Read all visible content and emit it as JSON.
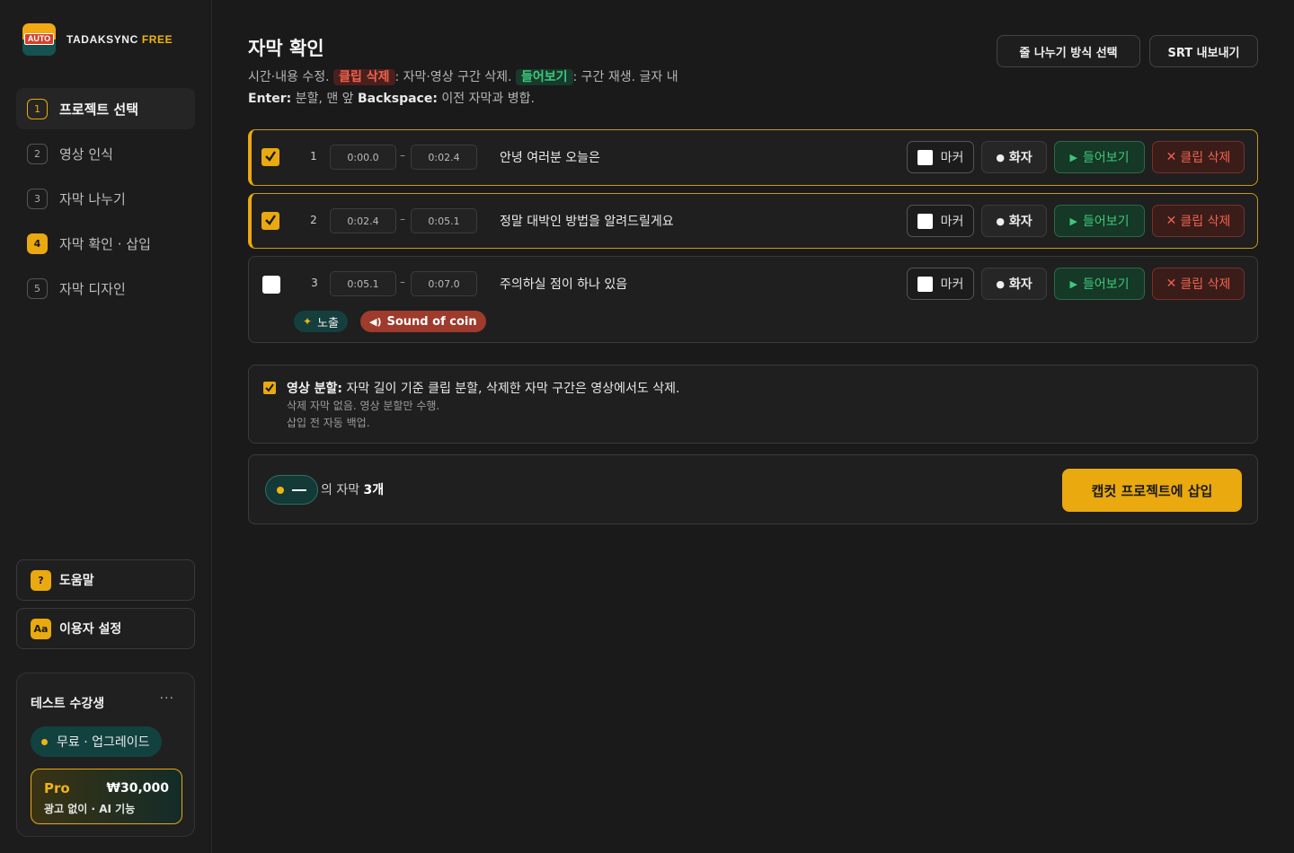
{
  "brand": {
    "logo_text": "AUTO",
    "name": "TADAKSYNC",
    "tier": "FREE"
  },
  "steps": [
    {
      "num": "1",
      "label": "프로젝트 선택"
    },
    {
      "num": "2",
      "label": "영상 인식"
    },
    {
      "num": "3",
      "label": "자막 나누기"
    },
    {
      "num": "4",
      "label": "자막 확인 · 삽입"
    },
    {
      "num": "5",
      "label": "자막 디자인"
    }
  ],
  "help": {
    "icon": "?",
    "label": "도움말"
  },
  "settings": {
    "icon": "Aa",
    "label": "이용자 설정"
  },
  "user": {
    "name": "테스트 수강생",
    "more": "···",
    "plan": "무료 · 업그레이드",
    "pro": {
      "name": "Pro",
      "price": "₩30,000",
      "desc": "광고 없이 · AI 기능"
    }
  },
  "header": {
    "title": "자막 확인",
    "desc_1": "시간·내용 수정. ",
    "tag_delete": "클립 삭제",
    "desc_2": ": 자막·영상 구간 삭제. ",
    "tag_listen": "들어보기",
    "desc_3": ": 구간 재생. 글자 내 ",
    "key_enter": "Enter:",
    "desc_4": " 분할, 맨 앞 ",
    "key_backspace": "Backspace:",
    "desc_5": " 이전 자막과 병합.",
    "btn_line_break": "줄 나누기 방식 선택",
    "btn_srt": "SRT 내보내기"
  },
  "row_labels": {
    "marker": "마커",
    "speaker": "화자",
    "play": "들어보기",
    "delete": "클립 삭제",
    "dash": "–"
  },
  "subtitles": [
    {
      "num": "1",
      "start": "0:00.0",
      "end": "0:02.4",
      "text": "안녕 여러분 오늘은",
      "checked": true
    },
    {
      "num": "2",
      "start": "0:02.4",
      "end": "0:05.1",
      "text": "정말 대박인 방법을 알려드릴게요",
      "checked": true
    },
    {
      "num": "3",
      "start": "0:05.1",
      "end": "0:07.0",
      "text": "주의하실 점이 하나 있음",
      "checked": false,
      "chips": [
        {
          "label": "노출",
          "color": "#153f3c"
        },
        {
          "label": "Sound of coin",
          "color": "#9e3b2c"
        }
      ]
    }
  ],
  "split": {
    "title_bold": "영상 분할:",
    "title_rest": " 자막 길이 기준 클립 분할, 삭제한 자막 구간은 영상에서도 삭제.",
    "sub_1": "삭제 자막 없음. 영상 분할만 수행.",
    "sub_2": "삽입 전 자동 백업."
  },
  "insert": {
    "count_prefix": "의 자막 ",
    "count": "3개",
    "button": "캡컷 프로젝트에 삽입"
  },
  "colors": {
    "accent": "#e9a90f",
    "teal": "#133a37",
    "red": "#f0624f",
    "green": "#3fc77c"
  }
}
